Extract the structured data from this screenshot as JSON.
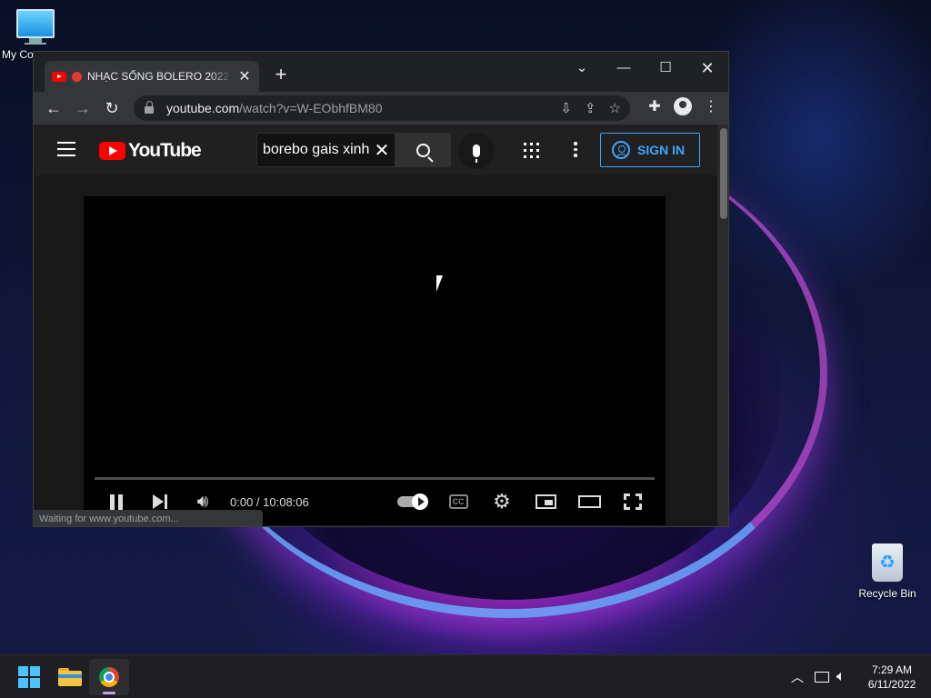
{
  "desktop": {
    "icons": [
      {
        "label": "My Co"
      },
      {
        "label": "Recycle Bin"
      }
    ]
  },
  "browser": {
    "tab": {
      "title": "NHẠC SỐNG BOLERO 2022 T",
      "close_icon": "close-icon"
    },
    "new_tab_symbol": "+",
    "window_controls": {
      "tab_search": "⌄",
      "minimize": "—",
      "maximize": "☐",
      "close": "✕"
    },
    "url": {
      "host": "youtube.com",
      "path": "/watch?v=W-EObhfBM80"
    },
    "status_text": "Waiting for www.youtube.com..."
  },
  "youtube": {
    "logo_text": "YouTube",
    "search_value": "borebo gais xinh",
    "sign_in_label": "SIGN IN",
    "player": {
      "time": "0:00 / 10:08:06",
      "progress": 0,
      "autoplay": true,
      "cc_label": "CC"
    }
  },
  "taskbar": {
    "time": "7:29 AM",
    "date": "6/11/2022"
  },
  "colors": {
    "accent_blue": "#3ea6ff",
    "youtube_red": "#ff0000",
    "chrome_dark": "#202124",
    "tab_active": "#35363a"
  }
}
